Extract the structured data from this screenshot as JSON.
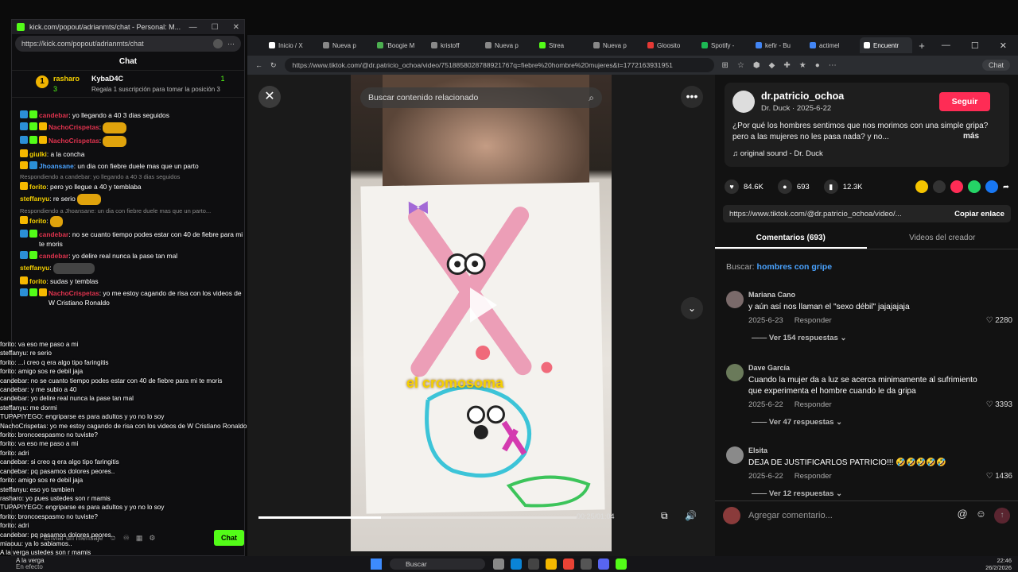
{
  "kick": {
    "title": "kick.com/popout/adrianmts/chat - Personal: M...",
    "url": "https://kick.com/popout/adrianmts/chat",
    "chat_header": "Chat",
    "subs": {
      "rank1": "1",
      "user1": "rasharo",
      "count1": "3",
      "user2": "KybaD4C",
      "count2": "1",
      "gift_text": "Regala 1 suscripción para tomar la posición 3"
    },
    "messages": [
      {
        "user": "candebar",
        "text": ": yo llegando a 40 3 dias seguidos",
        "color": "red"
      },
      {
        "user": "NachoCrispetas",
        "text": ":",
        "color": "red"
      },
      {
        "user": "NachoCrispetas",
        "text": ":",
        "color": "red"
      },
      {
        "user": "giulki",
        "text": ": a la concha",
        "color": "yel"
      },
      {
        "user": "Jhoansane",
        "text": ": un dia con fiebre duele mas que un parto",
        "color": "blue"
      },
      {
        "reply": "Respondiendo a candebar: yo llegando a 40 3 dias seguidos"
      },
      {
        "user": "forito",
        "text": ": pero yo llegue a 40 y temblaba",
        "color": "yel"
      },
      {
        "user": "steffanyu",
        "text": ": re serio",
        "color": "yel"
      },
      {
        "reply": "Respondiendo a Jhoansane: un dia con fiebre duele mas que un parto..."
      },
      {
        "user": "forito",
        "text": ":",
        "color": "yel"
      },
      {
        "user": "candebar",
        "text": ": no se cuanto tiempo podes estar con 40 de fiebre para mi te moris",
        "color": "red"
      },
      {
        "user": "candebar",
        "text": ": yo delire real nunca la pase tan mal",
        "color": "red"
      },
      {
        "user": "steffanyu",
        "text": ":",
        "color": "yel"
      },
      {
        "user": "forito",
        "text": ": sudas y temblas",
        "color": "yel"
      },
      {
        "user": "NachoCrispetas",
        "text": ": yo me estoy cagando de risa con los videos de W Cristiano Ronaldo",
        "color": "red"
      }
    ],
    "input_placeholder": "Enviar un mensaje",
    "chat_button": "Chat"
  },
  "overlay_lines": [
    "forito: va eso me paso a mi",
    "steffanyu: re serio",
    "forito: ...i creo q era algo tipo faringitis",
    "forito: amigo sos re debil jaja",
    "candebar: no se cuanto tiempo podes estar con 40 de fiebre para mi te moris",
    "candebar: y me subio a 40",
    "candebar: yo delire real nunca la pase tan mal",
    "steffanyu: me dormi",
    "TUPAPIYEGO: engriparse es para adultos y yo no lo soy",
    "NachoCrispetas: yo me estoy cagando de risa con los videos de W Cristiano Ronaldo",
    "forito: broncoespasmo no tuviste?",
    "forito: va eso me paso a mi",
    "forito: adri",
    "candebar: si creo q era algo tipo faringitis",
    "candebar: pq pasamos dolores peores..",
    "forito: amigo sos re debil jaja",
    "steffanyu: eso yo tambien",
    "rasharo: yo pues ustedes son r mamis",
    "TUPAPIYEGO: engriparse es para adultos y yo no lo soy",
    "forito: broncoespasmo no tuviste?",
    "forito: adri",
    "candebar: pq pasamos dolores peores..",
    "miaouu: ya lo sabiamos..",
    "A la verga ustedes son r mamis"
  ],
  "browser": {
    "tabs": [
      {
        "label": "Inicio / X",
        "color": "#ffffff"
      },
      {
        "label": "Nueva p",
        "color": "#888888"
      },
      {
        "label": "'Boogie M",
        "color": "#4caf50"
      },
      {
        "label": "kristoff",
        "color": "#888888"
      },
      {
        "label": "Nueva p",
        "color": "#888888"
      },
      {
        "label": "Strea",
        "color": "#53fc18"
      },
      {
        "label": "Nueva p",
        "color": "#888888"
      },
      {
        "label": "Gloosito",
        "color": "#e53935"
      },
      {
        "label": "Spotify -",
        "color": "#1db954"
      },
      {
        "label": "kefir - Bu",
        "color": "#4285f4"
      },
      {
        "label": "actimel",
        "color": "#4285f4"
      },
      {
        "label": "Encuentr",
        "color": "#ffffff"
      }
    ],
    "url": "https://www.tiktok.com/@dr.patricio_ochoa/video/7518858028788921767q=fiebre%20hombre%20mujeres&t=1772163931951",
    "chat_pill": "Chat"
  },
  "tiktok": {
    "search_placeholder": "Buscar contenido relacionado",
    "caption": "el cromosoma",
    "progress": 0.385,
    "time": "00:25/01:04",
    "author": "dr.patricio_ochoa",
    "author_sub": "Dr. Duck · 2025-6-22",
    "follow": "Seguir",
    "description": "¿Por qué los hombres sentimos que nos morimos con una simple gripa? pero a las mujeres no les pasa nada? y no...",
    "more": "más",
    "sound": "original sound - Dr. Duck",
    "likes": "84.6K",
    "comments_count": "693",
    "saves": "12.3K",
    "link": "https://www.tiktok.com/@dr.patricio_ochoa/video/...",
    "copy_link": "Copiar enlace",
    "tab_comments": "Comentarios (693)",
    "tab_creator": "Videos del creador",
    "search_label": "Buscar:",
    "search_term": "hombres con gripe",
    "comments": [
      {
        "user": "Mariana Cano",
        "text": "y aún así nos llaman el \"sexo débil\" jajajajaja",
        "date": "2025-6-23",
        "reply": "Responder",
        "likes": "2280",
        "replies": "Ver 154 respuestas"
      },
      {
        "user": "Dave García",
        "text": "Cuando la mujer da a luz se acerca minimamente al sufrimiento que experimenta el hombre cuando le da gripa",
        "date": "2025-6-22",
        "reply": "Responder",
        "likes": "3393",
        "replies": "Ver 47 respuestas"
      },
      {
        "user": "Elsita",
        "text": "DEJA DE JUSTIFICARLOS PATRICIO!!! 🤣🤣🤣🤣🤣",
        "date": "2025-6-22",
        "reply": "Responder",
        "likes": "1436",
        "replies": "Ver 12 respuestas"
      }
    ],
    "add_comment": "Agregar comentario..."
  },
  "taskbar": {
    "search": "Buscar",
    "news": "A la verga",
    "news2": "En efecto",
    "time": "22:46",
    "date": "26/2/2026"
  },
  "colors": {
    "kick_green": "#53fc18",
    "tiktok_red": "#fe2c55",
    "link_blue": "#4aa3ff"
  }
}
